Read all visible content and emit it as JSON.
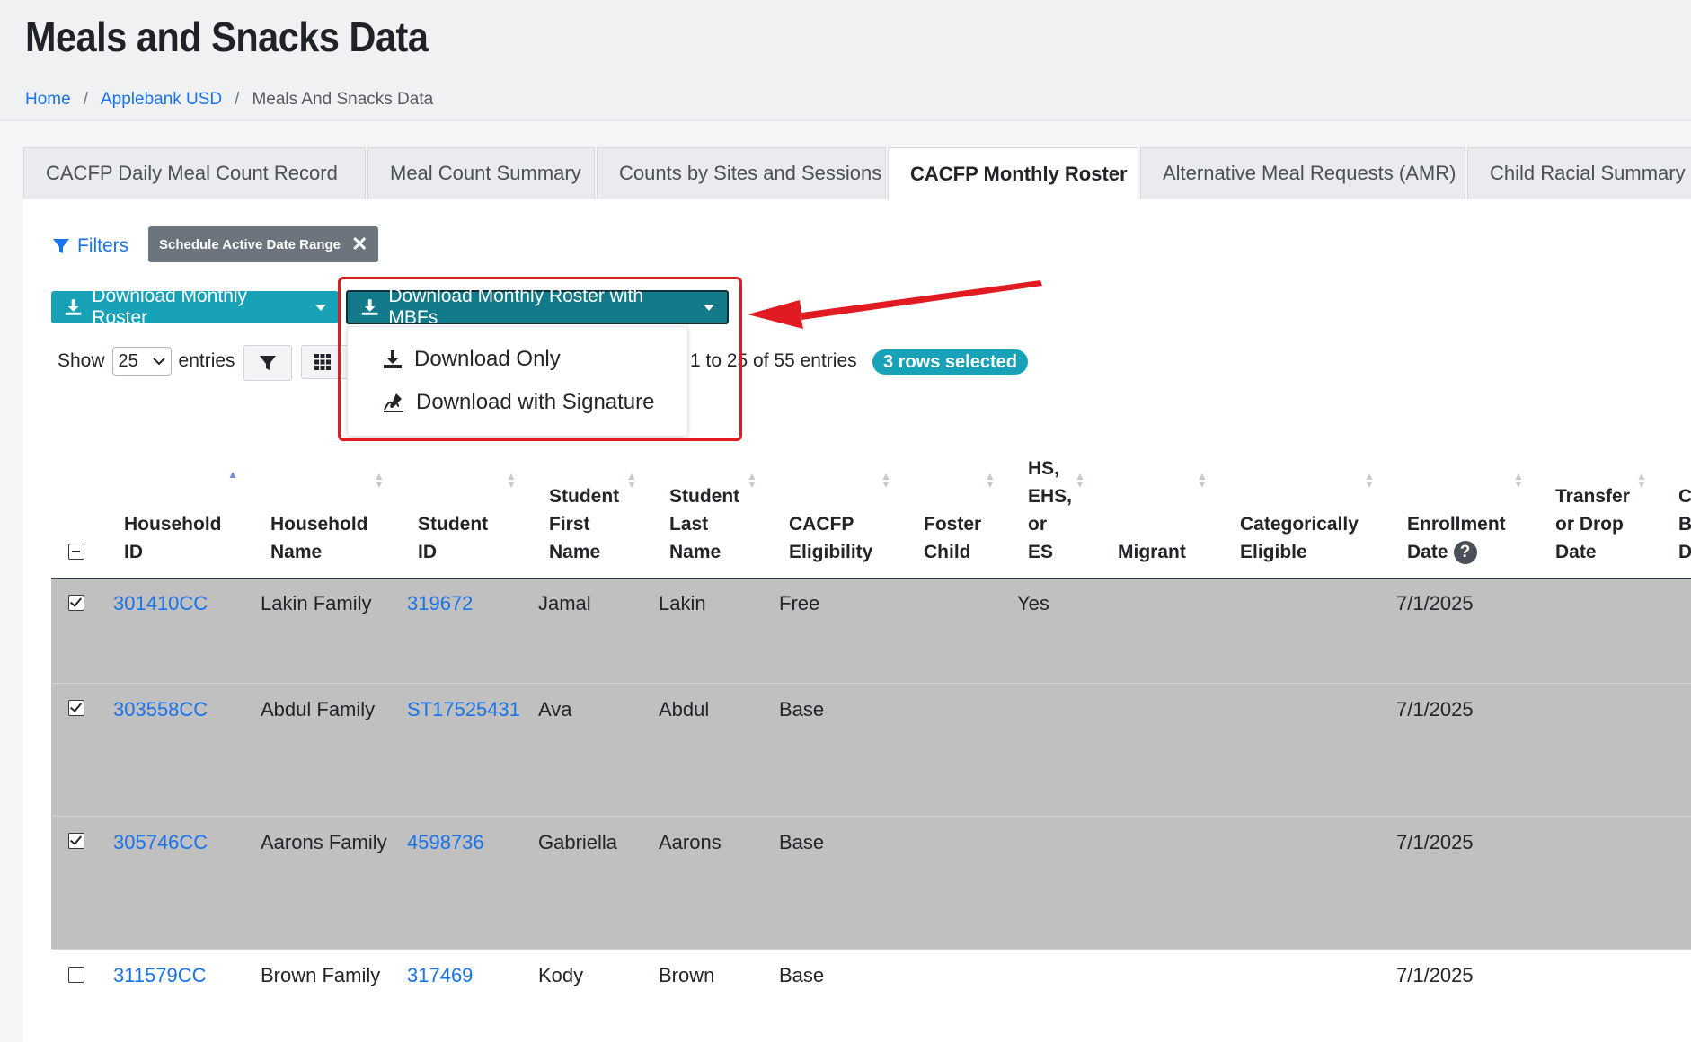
{
  "header": {
    "title": "Meals and Snacks Data",
    "breadcrumb": {
      "home": "Home",
      "district": "Applebank USD",
      "current": "Meals And Snacks Data"
    }
  },
  "tabs": [
    {
      "label": "CACFP Daily Meal Count Record",
      "active": false
    },
    {
      "label": "Meal Count Summary",
      "active": false
    },
    {
      "label": "Counts by Sites and Sessions",
      "active": false
    },
    {
      "label": "CACFP Monthly Roster",
      "active": true
    },
    {
      "label": "Alternative Meal Requests (AMR)",
      "active": false
    },
    {
      "label": "Child Racial Summary",
      "active": false
    }
  ],
  "filters": {
    "label": "Filters",
    "chip_label": "Schedule Active Date Range"
  },
  "buttons": {
    "download_roster": "Download Monthly Roster",
    "download_roster_mbfs": "Download Monthly Roster with MBFs"
  },
  "dropdown": {
    "download_only": "Download Only",
    "download_signature": "Download with Signature"
  },
  "length_control": {
    "show": "Show",
    "value": "25",
    "entries": "entries"
  },
  "info": {
    "text": "1 to 25 of 55 entries",
    "selected": "3 rows selected"
  },
  "columns": {
    "household_id": [
      "Household",
      "ID"
    ],
    "household_name": [
      "Household",
      "Name"
    ],
    "student_id": [
      "Student",
      "ID"
    ],
    "first_name": [
      "Student",
      "First",
      "Name"
    ],
    "last_name": [
      "Student",
      "Last",
      "Name"
    ],
    "eligibility": [
      "CACFP",
      "Eligibility"
    ],
    "foster": [
      "Foster",
      "Child"
    ],
    "hs": [
      "HS,",
      "EHS,",
      "or",
      "ES"
    ],
    "migrant": [
      "Migrant"
    ],
    "categorical": [
      "Categorically",
      "Eligible"
    ],
    "enrollment": [
      "Enrollment",
      "Date"
    ],
    "transfer": [
      "Transfer",
      "or Drop",
      "Date"
    ],
    "partial": [
      "C",
      "B",
      "D"
    ]
  },
  "rows": [
    {
      "selected": true,
      "household_id": "301410CC",
      "household_name": "Lakin Family",
      "student_id": "319672",
      "first": "Jamal",
      "last": "Lakin",
      "eligibility": "Free",
      "hs": "Yes",
      "enrollment": "7/1/2025"
    },
    {
      "selected": true,
      "household_id": "303558CC",
      "household_name": "Abdul Family",
      "student_id": "ST17525431",
      "first": "Ava",
      "last": "Abdul",
      "eligibility": "Base",
      "hs": "",
      "enrollment": "7/1/2025"
    },
    {
      "selected": true,
      "household_id": "305746CC",
      "household_name": "Aarons Family",
      "student_id": "4598736",
      "first": "Gabriella",
      "last": "Aarons",
      "eligibility": "Base",
      "hs": "",
      "enrollment": "7/1/2025"
    },
    {
      "selected": false,
      "household_id": "311579CC",
      "household_name": "Brown Family",
      "student_id": "317469",
      "first": "Kody",
      "last": "Brown",
      "eligibility": "Base",
      "hs": "",
      "enrollment": "7/1/2025"
    }
  ],
  "colors": {
    "accent": "#17a2b8",
    "accent_dark": "#137a8a",
    "link": "#1a73e8",
    "highlight": "#e11b22",
    "selected_row": "#c0c0c0"
  }
}
